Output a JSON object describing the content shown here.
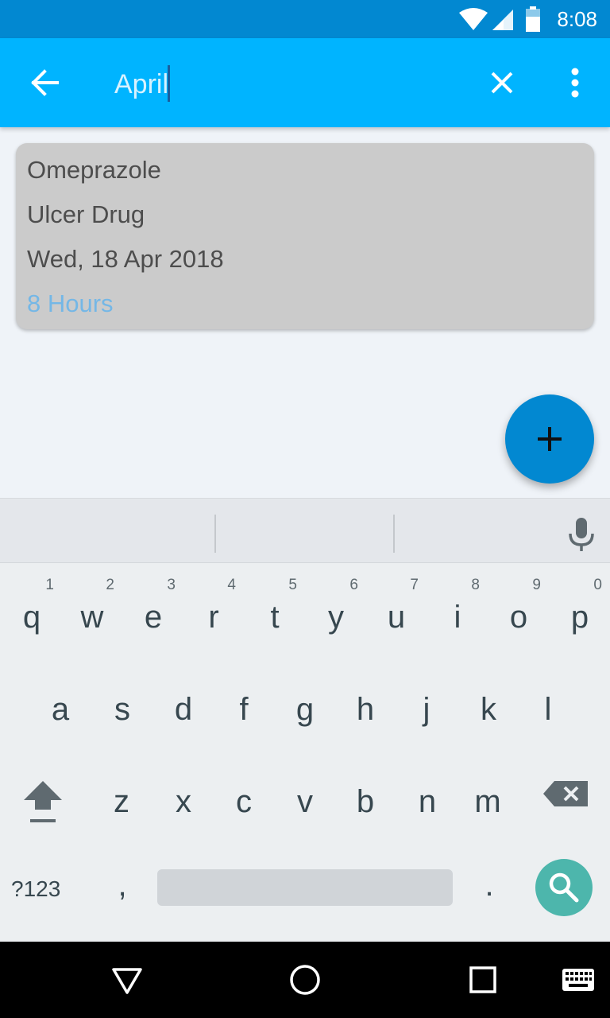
{
  "status_bar": {
    "time": "8:08",
    "icons": [
      "wifi-icon",
      "cell-signal-icon",
      "battery-icon"
    ]
  },
  "app_bar": {
    "back_icon": "arrow-left-icon",
    "search_value": "April",
    "clear_icon": "close-icon",
    "menu_icon": "more-vert-icon"
  },
  "result_card": {
    "drug_name": "Omeprazole",
    "drug_type": "Ulcer Drug",
    "date": "Wed, 18 Apr 2018",
    "interval": "8 Hours",
    "interval_color": "#74b7e6"
  },
  "fab": {
    "icon": "plus-icon",
    "color": "#0288d1"
  },
  "keyboard": {
    "mic_icon": "microphone-icon",
    "row1": [
      {
        "letter": "q",
        "hint": "1"
      },
      {
        "letter": "w",
        "hint": "2"
      },
      {
        "letter": "e",
        "hint": "3"
      },
      {
        "letter": "r",
        "hint": "4"
      },
      {
        "letter": "t",
        "hint": "5"
      },
      {
        "letter": "y",
        "hint": "6"
      },
      {
        "letter": "u",
        "hint": "7"
      },
      {
        "letter": "i",
        "hint": "8"
      },
      {
        "letter": "o",
        "hint": "9"
      },
      {
        "letter": "p",
        "hint": "0"
      }
    ],
    "row2": [
      "a",
      "s",
      "d",
      "f",
      "g",
      "h",
      "j",
      "k",
      "l"
    ],
    "row3": [
      "z",
      "x",
      "c",
      "v",
      "b",
      "n",
      "m"
    ],
    "shift_icon": "shift-icon",
    "backspace_icon": "backspace-icon",
    "symbols_label": "?123",
    "comma_label": ",",
    "period_label": ".",
    "search_icon": "search-icon",
    "search_key_color": "#4db6ac"
  },
  "nav_bar": {
    "back_icon": "nav-back-icon",
    "home_icon": "nav-home-icon",
    "recents_icon": "nav-recents-icon",
    "keyboard_icon": "keyboard-icon"
  },
  "colors": {
    "status_bar": "#0288d1",
    "app_bar": "#00b4ff",
    "background": "#eff3f8",
    "card": "#cbcbcb"
  }
}
